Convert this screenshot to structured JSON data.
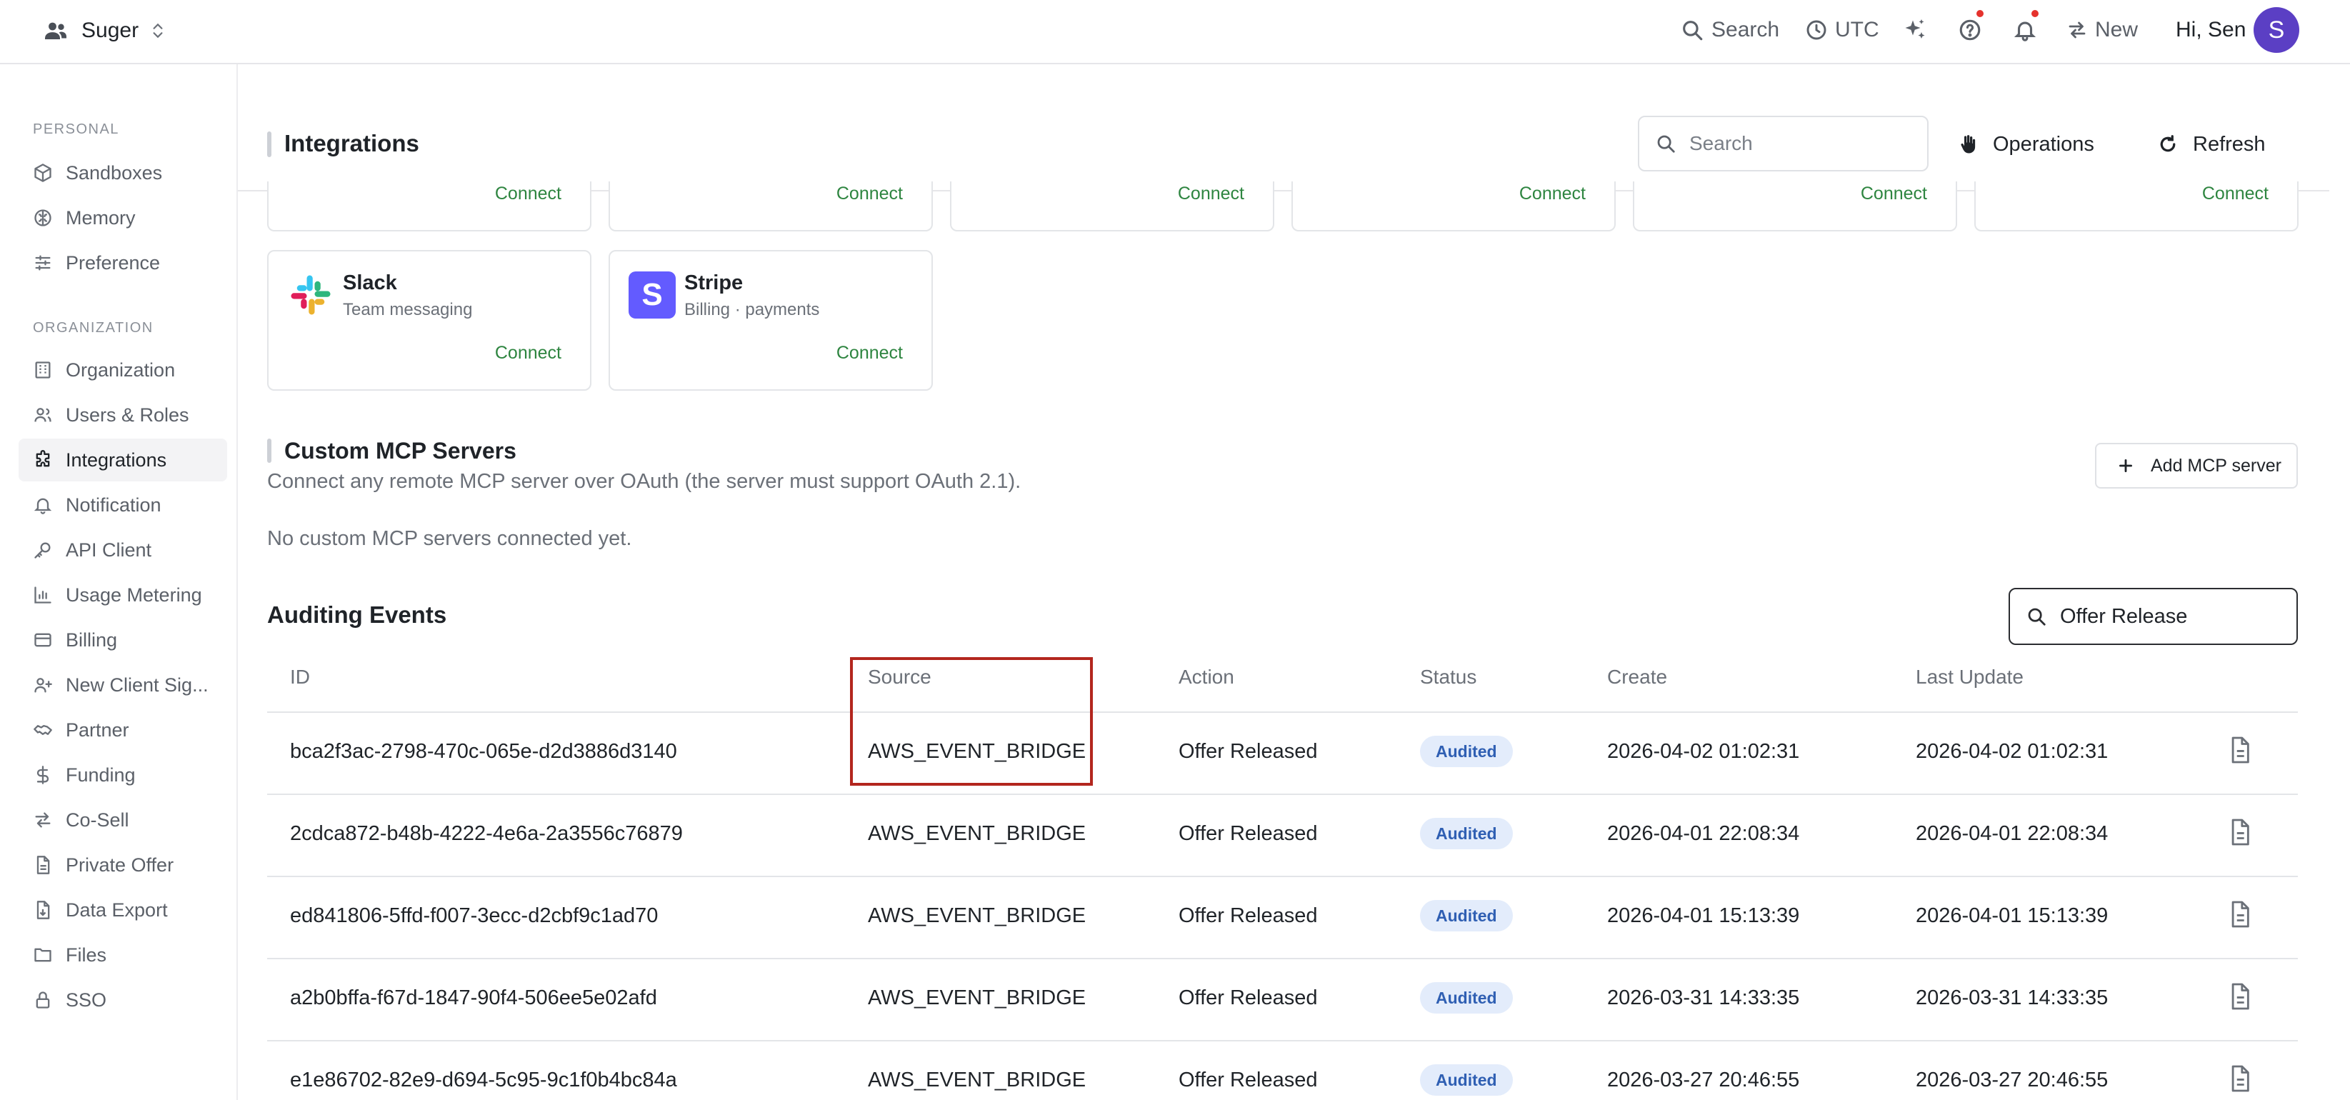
{
  "topbar": {
    "org_name": "Suger",
    "search_label": "Search",
    "timezone_label": "UTC",
    "new_label": "New",
    "greeting": "Hi, Sen",
    "avatar_initial": "S",
    "notification_dot_color": "#e5322d"
  },
  "sidebar": {
    "personal_label": "PERSONAL",
    "organization_label": "ORGANIZATION",
    "personal_items": [
      {
        "label": "Sandboxes",
        "icon": "cube-icon"
      },
      {
        "label": "Memory",
        "icon": "brain-icon"
      },
      {
        "label": "Preference",
        "icon": "sliders-icon"
      }
    ],
    "org_items": [
      {
        "label": "Organization",
        "icon": "building-icon"
      },
      {
        "label": "Users & Roles",
        "icon": "users-icon"
      },
      {
        "label": "Integrations",
        "icon": "puzzle-icon"
      },
      {
        "label": "Notification",
        "icon": "bell-icon"
      },
      {
        "label": "API Client",
        "icon": "key-icon"
      },
      {
        "label": "Usage Metering",
        "icon": "bar-chart-icon"
      },
      {
        "label": "Billing",
        "icon": "credit-card-icon"
      },
      {
        "label": "New Client Sig...",
        "icon": "user-plus-icon"
      },
      {
        "label": "Partner",
        "icon": "handshake-icon"
      },
      {
        "label": "Funding",
        "icon": "dollar-icon"
      },
      {
        "label": "Co-Sell",
        "icon": "arrows-exchange-icon"
      },
      {
        "label": "Private Offer",
        "icon": "document-icon"
      },
      {
        "label": "Data Export",
        "icon": "file-export-icon"
      },
      {
        "label": "Files",
        "icon": "folder-icon"
      },
      {
        "label": "SSO",
        "icon": "lock-icon"
      }
    ],
    "active_item": "Integrations"
  },
  "header": {
    "title": "Integrations",
    "search_placeholder": "Search",
    "operations_label": "Operations",
    "refresh_label": "Refresh"
  },
  "cards": {
    "connect_label": "Connect",
    "partial_count": 6,
    "full": [
      {
        "name": "Slack",
        "description": "Team messaging",
        "connect": "Connect",
        "icon": "slack-logo-icon"
      },
      {
        "name": "Stripe",
        "description": "Billing · payments",
        "connect": "Connect",
        "icon": "stripe-logo-icon",
        "logo_letter": "S",
        "logo_color": "#635bff"
      }
    ]
  },
  "mcp": {
    "title": "Custom MCP Servers",
    "description": "Connect any remote MCP server over OAuth (the server must support OAuth 2.1).",
    "add_label": "Add MCP server",
    "empty_text": "No custom MCP servers connected yet."
  },
  "audit": {
    "title": "Auditing Events",
    "search_value": "Offer Release",
    "columns": [
      "ID",
      "Source",
      "Action",
      "Status",
      "Create",
      "Last Update"
    ],
    "status_color": "#e3ecfb",
    "rows": [
      {
        "id": "bca2f3ac-2798-470c-065e-d2d3886d3140",
        "source": "AWS_EVENT_BRIDGE",
        "action": "Offer Released",
        "status": "Audited",
        "create": "2026-04-02 01:02:31",
        "update": "2026-04-02 01:02:31"
      },
      {
        "id": "2cdca872-b48b-4222-4e6a-2a3556c76879",
        "source": "AWS_EVENT_BRIDGE",
        "action": "Offer Released",
        "status": "Audited",
        "create": "2026-04-01 22:08:34",
        "update": "2026-04-01 22:08:34"
      },
      {
        "id": "ed841806-5ffd-f007-3ecc-d2cbf9c1ad70",
        "source": "AWS_EVENT_BRIDGE",
        "action": "Offer Released",
        "status": "Audited",
        "create": "2026-04-01 15:13:39",
        "update": "2026-04-01 15:13:39"
      },
      {
        "id": "a2b0bffa-f67d-1847-90f4-506ee5e02afd",
        "source": "AWS_EVENT_BRIDGE",
        "action": "Offer Released",
        "status": "Audited",
        "create": "2026-03-31 14:33:35",
        "update": "2026-03-31 14:33:35"
      },
      {
        "id": "e1e86702-82e9-d694-5c95-9c1f0b4bc84a",
        "source": "AWS_EVENT_BRIDGE",
        "action": "Offer Released",
        "status": "Audited",
        "create": "2026-03-27 20:46:55",
        "update": "2026-03-27 20:46:55"
      }
    ],
    "highlight_color": "#b3261e"
  }
}
